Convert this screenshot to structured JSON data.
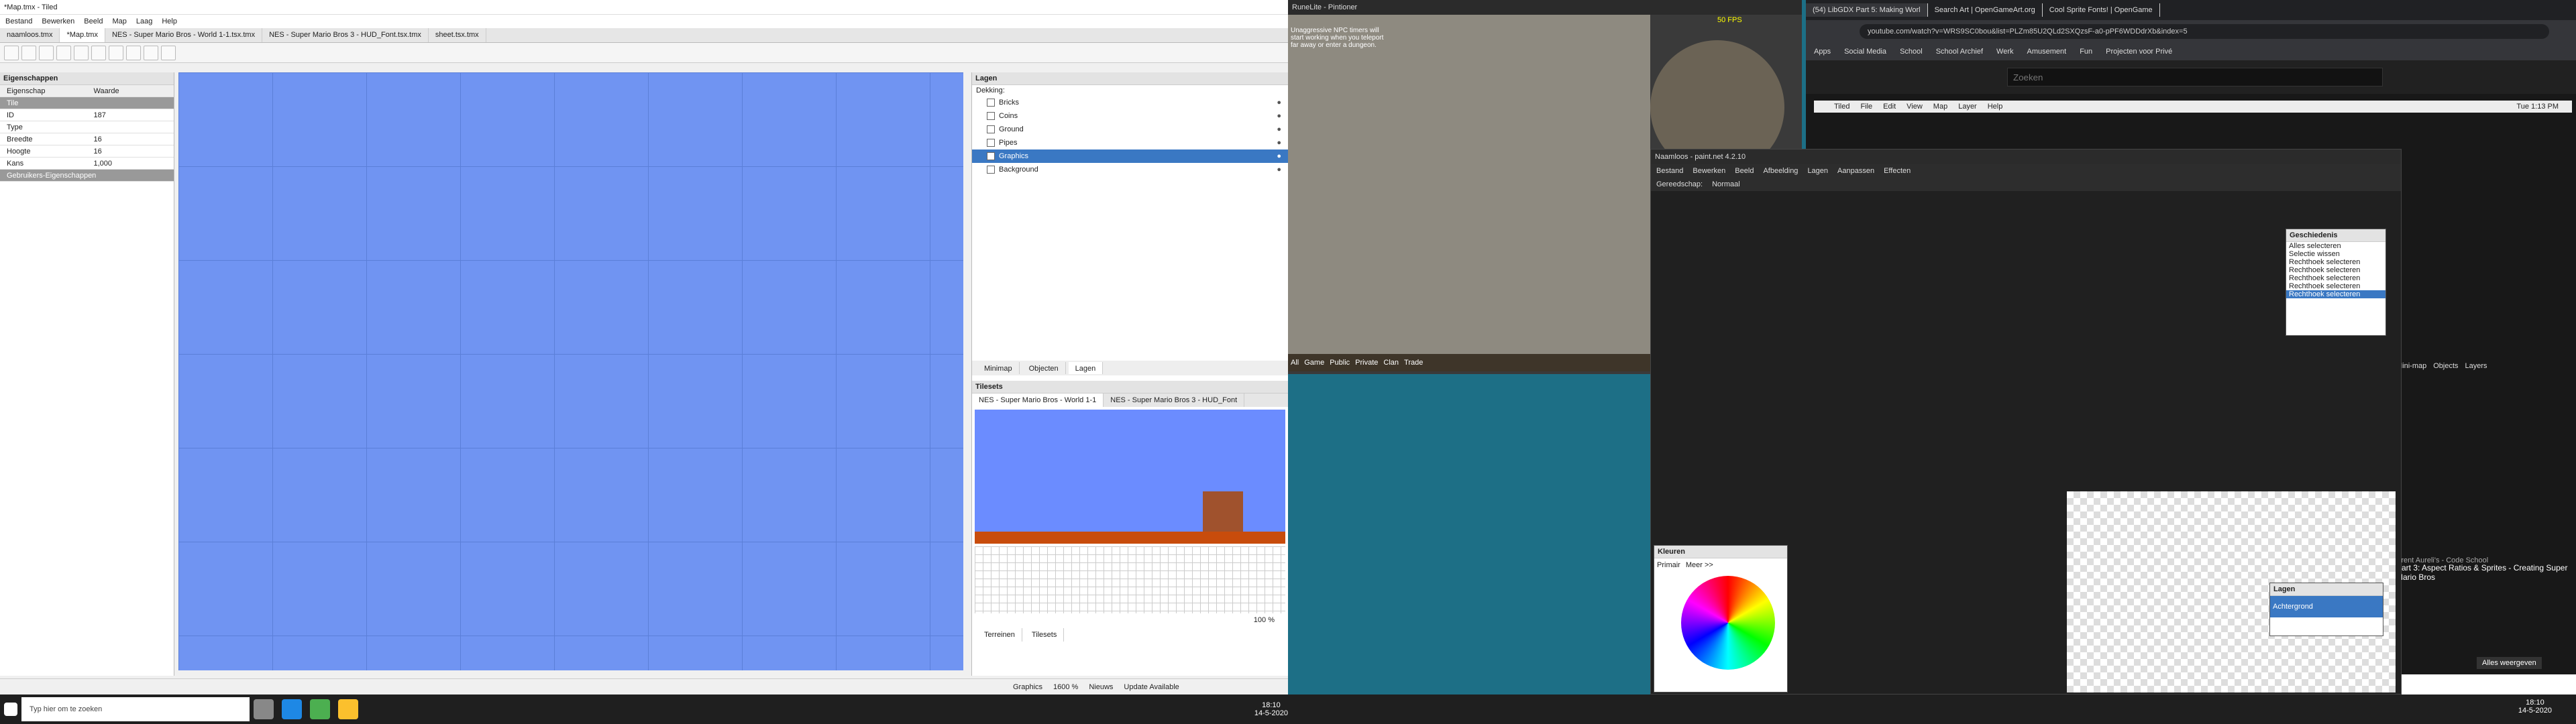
{
  "tiled": {
    "title": "*Map.tmx - Tiled",
    "menu": [
      "Bestand",
      "Bewerken",
      "Beeld",
      "Map",
      "Laag",
      "Help"
    ],
    "tabs": [
      "naamloos.tmx",
      "*Map.tmx",
      "NES - Super Mario Bros - World 1-1.tsx.tmx",
      "NES - Super Mario Bros 3 - HUD_Font.tsx.tmx",
      "sheet.tsx.tmx"
    ],
    "properties_title": "Eigenschappen",
    "prop_col1": "Eigenschap",
    "prop_col2": "Waarde",
    "props": [
      {
        "k": "Tile",
        "v": ""
      },
      {
        "k": "ID",
        "v": "187"
      },
      {
        "k": "Type",
        "v": ""
      },
      {
        "k": "Breedte",
        "v": "16"
      },
      {
        "k": "Hoogte",
        "v": "16"
      },
      {
        "k": "Kans",
        "v": "1,000"
      }
    ],
    "custom_props": "Gebruikers-Eigenschappen",
    "layers_title": "Lagen",
    "opacity_label": "Dekking:",
    "layers": [
      "Bricks",
      "Coins",
      "Ground",
      "Pipes",
      "Graphics",
      "Background"
    ],
    "selected_layer": "Graphics",
    "bottom_tabs": [
      "Minimap",
      "Objecten",
      "Lagen"
    ],
    "tilesets_title": "Tilesets",
    "tileset_tabs": [
      "NES - Super Mario Bros - World 1-1",
      "NES - Super Mario Bros 3 - HUD_Font"
    ],
    "terrain_tabs": [
      "Terreinen",
      "Tilesets"
    ],
    "zoom": "100 %",
    "status_layer": "Graphics",
    "status_zoom": "1600 %",
    "status_news": "Nieuws",
    "status_update": "Update Available"
  },
  "runelite": {
    "title": "RuneLite - Pintioner",
    "chat": "Unaggressive NPC timers will start working when you teleport far away or enter a dungeon.",
    "bottom": [
      "All",
      "Game",
      "Public",
      "Private",
      "Clan",
      "Trade"
    ],
    "fps": "50 FPS"
  },
  "paint": {
    "title": "Naamloos - paint.net 4.2.10",
    "menu": [
      "Bestand",
      "Bewerken",
      "Beeld",
      "Afbeelding",
      "Lagen",
      "Aanpassen",
      "Effecten"
    ],
    "tool_label": "Gereedschap:",
    "blend": "Normaal",
    "history_title": "Geschiedenis",
    "history": [
      "Alles selecteren",
      "Selectie wissen",
      "Rechthoek selecteren",
      "Rechthoek selecteren",
      "Rechthoek selecteren",
      "Rechthoek selecteren",
      "Rechthoek selecteren"
    ],
    "colors_title": "Kleuren",
    "primary": "Primair",
    "more": "Meer >>",
    "layers_title": "Lagen",
    "layer": "Achtergrond"
  },
  "chrome": {
    "tabs": [
      "(54) LibGDX Part 5: Making Worl",
      "Search Art | OpenGameArt.org",
      "Cool Sprite Fonts! | OpenGame"
    ],
    "url": "youtube.com/watch?v=WRS9SC0bou&list=PLZm85U2QLd2SXQzsF-a0-pPF6WDDdrXb&index=5",
    "bookmarks": [
      "Apps",
      "Social Media",
      "School",
      "School Archief",
      "Werk",
      "Amusement",
      "Fun",
      "Projecten voor Privé"
    ],
    "search_placeholder": "Zoeken",
    "video_menu": [
      "Tiled",
      "File",
      "Edit",
      "View",
      "Map",
      "Layer",
      "Help"
    ],
    "video_time": "Tue 1:13 PM",
    "video_title": "Part 3: Aspect Ratios & Sprites - Creating Super Mario Bros",
    "channel": "Brent Aureli's - Code School",
    "notification": "Alles weergeven",
    "video_tabs": [
      "Mini-map",
      "Objects",
      "Layers"
    ]
  },
  "taskbar": {
    "search": "Typ hier om te zoeken",
    "time1": "18:10",
    "date1": "14-5-2020",
    "time2": "18:10",
    "date2": "14-5-2020"
  }
}
